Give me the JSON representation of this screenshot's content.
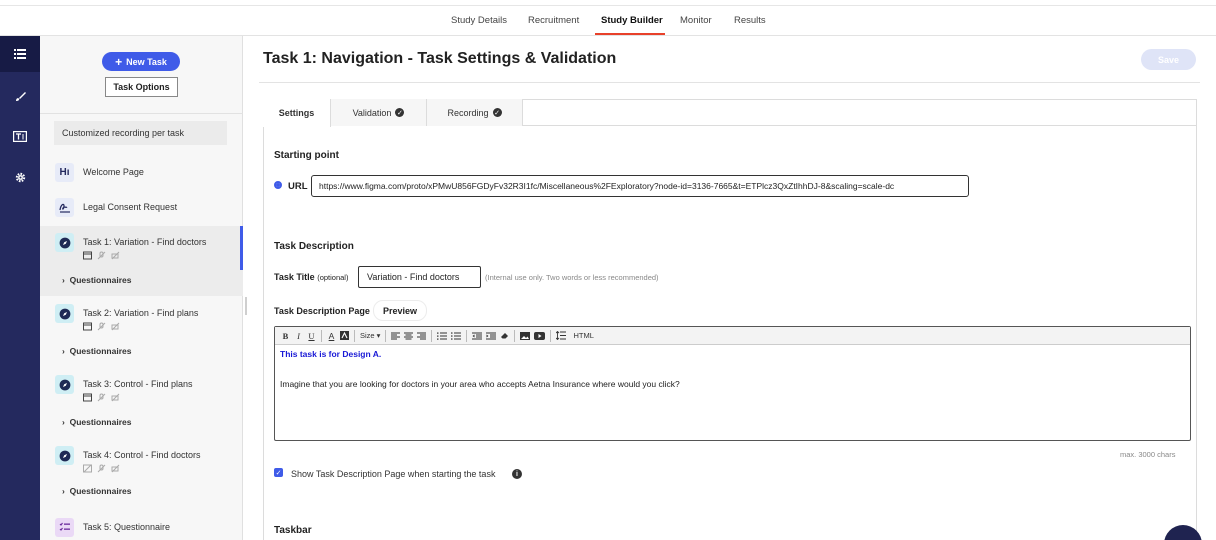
{
  "topnav": {
    "tabs": [
      {
        "label": "Study Details",
        "active": false
      },
      {
        "label": "Recruitment",
        "active": false
      },
      {
        "label": "Study Builder",
        "active": true
      },
      {
        "label": "Monitor",
        "active": false
      },
      {
        "label": "Results",
        "active": false
      }
    ],
    "accent_color": "#e8412a"
  },
  "rail": {
    "icons": [
      "list-icon",
      "brush-icon",
      "text-box-icon",
      "gear-icon"
    ],
    "color": "#24295e"
  },
  "sidebar": {
    "new_task_label": "New Task",
    "task_options_label": "Task Options",
    "filter_label": "Customized recording per task",
    "items": [
      {
        "label": "Welcome Page",
        "icon": "heading-icon"
      },
      {
        "label": "Legal Consent Request",
        "icon": "signature-icon"
      },
      {
        "label": "Task 1: Variation - Find doctors",
        "icon": "compass-icon",
        "questionnaires": "Questionnaires",
        "selected": true
      },
      {
        "label": "Task 2: Variation - Find plans",
        "icon": "compass-icon",
        "questionnaires": "Questionnaires"
      },
      {
        "label": "Task 3: Control - Find plans",
        "icon": "compass-icon",
        "questionnaires": "Questionnaires"
      },
      {
        "label": "Task 4: Control - Find doctors",
        "icon": "compass-icon",
        "questionnaires": "Questionnaires"
      },
      {
        "label": "Task 5: Questionnaire",
        "icon": "checklist-icon"
      }
    ]
  },
  "main": {
    "title": "Task 1: Navigation - Task Settings & Validation",
    "save_label": "Save",
    "tabs": [
      {
        "label": "Settings",
        "active": true
      },
      {
        "label": "Validation",
        "checked": true
      },
      {
        "label": "Recording",
        "checked": true
      }
    ],
    "starting_point": {
      "heading": "Starting point",
      "url_label": "URL",
      "url_value": "https://www.figma.com/proto/xPMwU856FGDyFv32R3I1fc/Miscellaneous%2FExploratory?node-id=3136-7665&t=ETPlcz3QxZtIhhDJ-8&scaling=scale-dc"
    },
    "task_description": {
      "heading": "Task Description",
      "title_label": "Task Title",
      "title_optional": "(optional)",
      "title_value": "Variation - Find doctors",
      "title_hint": "(Internal use only. Two words or less recommended)",
      "page_label": "Task Description Page",
      "preview_label": "Preview",
      "toolbar": {
        "bold": "B",
        "italic": "I",
        "underline": "U",
        "font_color": "A",
        "size_label": "Size",
        "html_label": "HTML"
      },
      "content_line1": "This task is for Design A.",
      "content_line2": "Imagine that you are looking for doctors in your area who accepts Aetna Insurance where would you click?",
      "max_chars": "max. 3000 chars",
      "show_page_label": "Show Task Description Page when starting the task"
    },
    "taskbar_heading": "Taskbar",
    "brand_color": "#3f5be8"
  }
}
